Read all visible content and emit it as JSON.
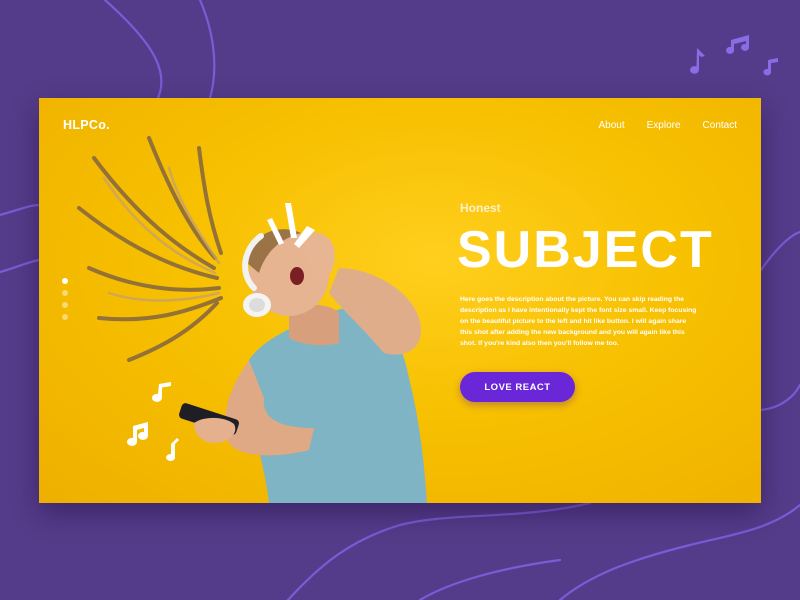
{
  "brand": {
    "logo_text": "HLPCo."
  },
  "nav": {
    "items": [
      "About",
      "Explore",
      "Contact"
    ]
  },
  "hero": {
    "eyebrow": "Honest",
    "title": "SUBJECT",
    "description": "Here goes the description about the picture. You can skip reading the description as I have intentionally kept the font size small. Keep focusing on the beautiful picture to the left and hit like button. I will again share this shot after adding the new background and you will again like this shot. If you're kind also then you'll follow me too.",
    "cta_label": "LOVE REACT"
  },
  "slider": {
    "count": 4,
    "active_index": 0
  },
  "icons": [
    "music-note-icon",
    "double-music-note-icon",
    "burst-icon"
  ],
  "colors": {
    "page_background": "#553c8a",
    "hero_background": "#f6bd00",
    "accent": "#6a27d8",
    "curve": "#7b5bd6"
  }
}
